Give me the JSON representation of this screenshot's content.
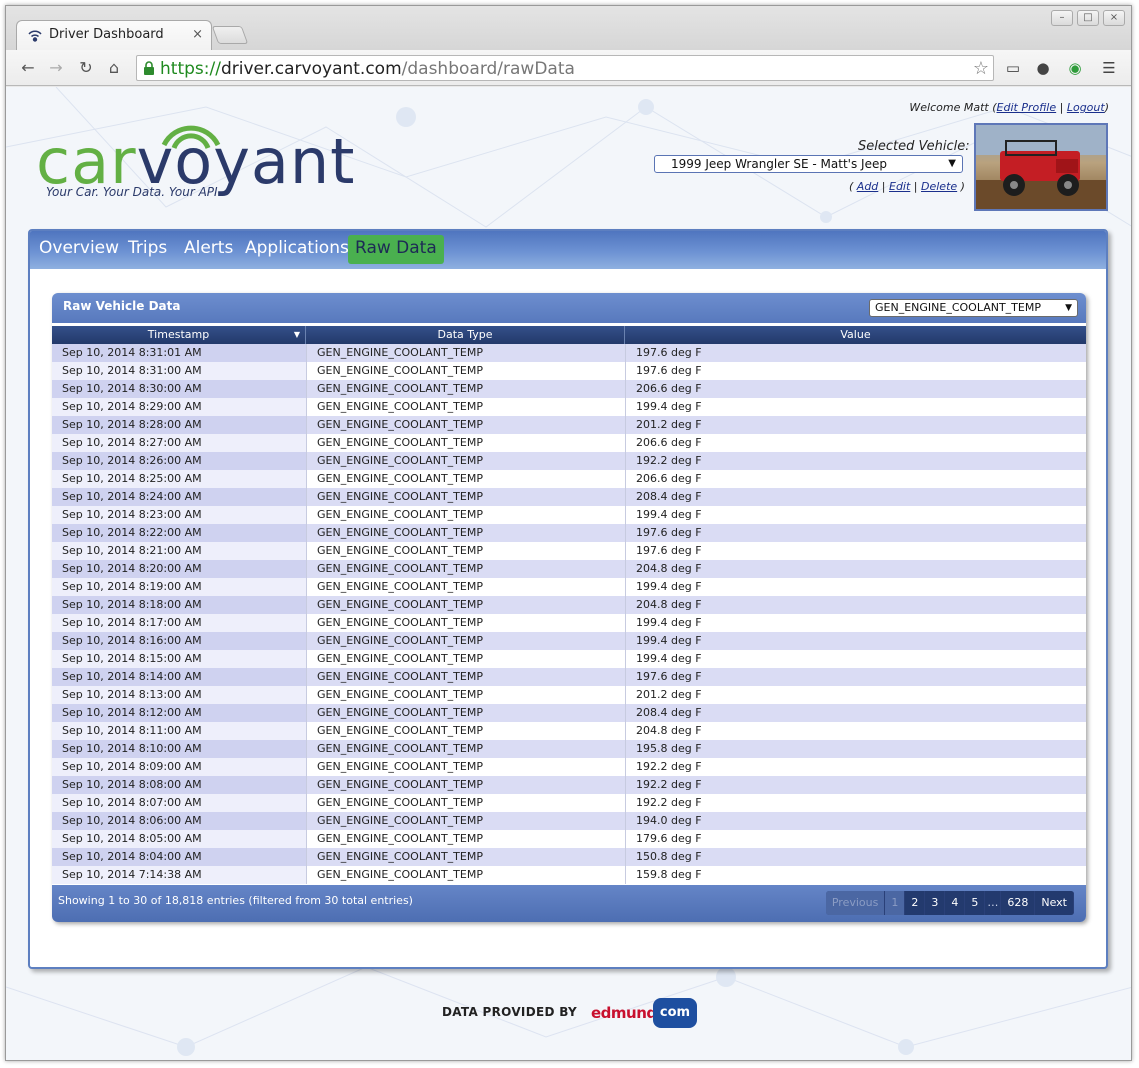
{
  "browser": {
    "tab_title": "Driver Dashboard",
    "tab_close": "×",
    "url_scheme": "https://",
    "url_host": "driver.carvoyant.com",
    "url_path": "/dashboard/rawData",
    "win_minimize": "–",
    "win_maximize": "□",
    "win_close": "×"
  },
  "header": {
    "welcome_prefix": "Welcome Matt (",
    "edit_profile": "Edit Profile",
    "separator": " | ",
    "logout": "Logout",
    "welcome_suffix": ")",
    "logo_car": "car",
    "logo_voyant": "voyant",
    "tagline": "Your Car. Your Data. Your API.",
    "selected_vehicle_label": "Selected Vehicle:",
    "selected_vehicle": "1999 Jeep Wrangler SE - Matt's Jeep",
    "vehicle_links_open": "( ",
    "add": "Add",
    "edit": "Edit",
    "delete": "Delete",
    "vehicle_links_close": " )"
  },
  "nav": {
    "items": [
      "Overview",
      "Trips",
      "Alerts",
      "Applications",
      "Raw Data"
    ],
    "active": "Raw Data"
  },
  "grid": {
    "title": "Raw Vehicle Data",
    "filter_value": "GEN_ENGINE_COOLANT_TEMP",
    "columns": [
      "Timestamp",
      "Data Type",
      "Value"
    ],
    "rows": [
      [
        "Sep 10, 2014 8:31:01 AM",
        "GEN_ENGINE_COOLANT_TEMP",
        "197.6 deg F"
      ],
      [
        "Sep 10, 2014 8:31:00 AM",
        "GEN_ENGINE_COOLANT_TEMP",
        "197.6 deg F"
      ],
      [
        "Sep 10, 2014 8:30:00 AM",
        "GEN_ENGINE_COOLANT_TEMP",
        "206.6 deg F"
      ],
      [
        "Sep 10, 2014 8:29:00 AM",
        "GEN_ENGINE_COOLANT_TEMP",
        "199.4 deg F"
      ],
      [
        "Sep 10, 2014 8:28:00 AM",
        "GEN_ENGINE_COOLANT_TEMP",
        "201.2 deg F"
      ],
      [
        "Sep 10, 2014 8:27:00 AM",
        "GEN_ENGINE_COOLANT_TEMP",
        "206.6 deg F"
      ],
      [
        "Sep 10, 2014 8:26:00 AM",
        "GEN_ENGINE_COOLANT_TEMP",
        "192.2 deg F"
      ],
      [
        "Sep 10, 2014 8:25:00 AM",
        "GEN_ENGINE_COOLANT_TEMP",
        "206.6 deg F"
      ],
      [
        "Sep 10, 2014 8:24:00 AM",
        "GEN_ENGINE_COOLANT_TEMP",
        "208.4 deg F"
      ],
      [
        "Sep 10, 2014 8:23:00 AM",
        "GEN_ENGINE_COOLANT_TEMP",
        "199.4 deg F"
      ],
      [
        "Sep 10, 2014 8:22:00 AM",
        "GEN_ENGINE_COOLANT_TEMP",
        "197.6 deg F"
      ],
      [
        "Sep 10, 2014 8:21:00 AM",
        "GEN_ENGINE_COOLANT_TEMP",
        "197.6 deg F"
      ],
      [
        "Sep 10, 2014 8:20:00 AM",
        "GEN_ENGINE_COOLANT_TEMP",
        "204.8 deg F"
      ],
      [
        "Sep 10, 2014 8:19:00 AM",
        "GEN_ENGINE_COOLANT_TEMP",
        "199.4 deg F"
      ],
      [
        "Sep 10, 2014 8:18:00 AM",
        "GEN_ENGINE_COOLANT_TEMP",
        "204.8 deg F"
      ],
      [
        "Sep 10, 2014 8:17:00 AM",
        "GEN_ENGINE_COOLANT_TEMP",
        "199.4 deg F"
      ],
      [
        "Sep 10, 2014 8:16:00 AM",
        "GEN_ENGINE_COOLANT_TEMP",
        "199.4 deg F"
      ],
      [
        "Sep 10, 2014 8:15:00 AM",
        "GEN_ENGINE_COOLANT_TEMP",
        "199.4 deg F"
      ],
      [
        "Sep 10, 2014 8:14:00 AM",
        "GEN_ENGINE_COOLANT_TEMP",
        "197.6 deg F"
      ],
      [
        "Sep 10, 2014 8:13:00 AM",
        "GEN_ENGINE_COOLANT_TEMP",
        "201.2 deg F"
      ],
      [
        "Sep 10, 2014 8:12:00 AM",
        "GEN_ENGINE_COOLANT_TEMP",
        "208.4 deg F"
      ],
      [
        "Sep 10, 2014 8:11:00 AM",
        "GEN_ENGINE_COOLANT_TEMP",
        "204.8 deg F"
      ],
      [
        "Sep 10, 2014 8:10:00 AM",
        "GEN_ENGINE_COOLANT_TEMP",
        "195.8 deg F"
      ],
      [
        "Sep 10, 2014 8:09:00 AM",
        "GEN_ENGINE_COOLANT_TEMP",
        "192.2 deg F"
      ],
      [
        "Sep 10, 2014 8:08:00 AM",
        "GEN_ENGINE_COOLANT_TEMP",
        "192.2 deg F"
      ],
      [
        "Sep 10, 2014 8:07:00 AM",
        "GEN_ENGINE_COOLANT_TEMP",
        "192.2 deg F"
      ],
      [
        "Sep 10, 2014 8:06:00 AM",
        "GEN_ENGINE_COOLANT_TEMP",
        "194.0 deg F"
      ],
      [
        "Sep 10, 2014 8:05:00 AM",
        "GEN_ENGINE_COOLANT_TEMP",
        "179.6 deg F"
      ],
      [
        "Sep 10, 2014 8:04:00 AM",
        "GEN_ENGINE_COOLANT_TEMP",
        "150.8 deg F"
      ],
      [
        "Sep 10, 2014 7:14:38 AM",
        "GEN_ENGINE_COOLANT_TEMP",
        "159.8 deg F"
      ]
    ],
    "info": "Showing 1 to 30 of 18,818 entries (filtered from 30 total entries)",
    "pager": {
      "previous": "Previous",
      "pages": [
        "1",
        "2",
        "3",
        "4",
        "5"
      ],
      "ellipsis": "…",
      "last": "628",
      "next": "Next",
      "current": "1"
    }
  },
  "footer": {
    "provided_by": "DATA PROVIDED BY",
    "brand_ed": "edmunds",
    "brand_com": "com"
  },
  "colors": {
    "nav_active": "#4ab04f",
    "logo_green": "#63b044",
    "logo_navy": "#2b3a6a",
    "grid_header": "#5879bd"
  }
}
